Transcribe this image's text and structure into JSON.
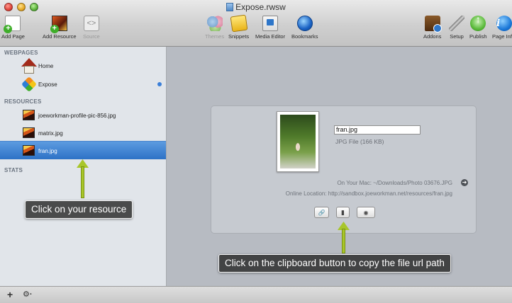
{
  "window": {
    "title": "Expose.rwsw"
  },
  "toolbar": {
    "add_page": "Add Page",
    "add_resource": "Add Resource",
    "source": "Source",
    "themes": "Themes",
    "snippets": "Snippets",
    "media_editor": "Media Editor",
    "bookmarks": "Bookmarks",
    "addons": "Addons",
    "setup": "Setup",
    "publish": "Publish",
    "page_info": "Page Info",
    "source_glyph": "<>",
    "info_glyph": "i"
  },
  "sidebar": {
    "webpages_header": "WEBPAGES",
    "webpages": [
      {
        "label": "Home"
      },
      {
        "label": "Expose"
      }
    ],
    "resources_header": "RESOURCES",
    "resources": [
      {
        "label": "joeworkman-profile-pic-856.jpg"
      },
      {
        "label": "matrix.jpg"
      },
      {
        "label": "fran.jpg"
      }
    ],
    "stats_header": "STATS"
  },
  "bottombar": {
    "add_glyph": "+",
    "gear_glyph": "⚙·"
  },
  "resource_panel": {
    "file_name": "fran.jpg",
    "file_type": "JPG File (166 KB)",
    "on_your_mac": "On Your Mac: ~/Downloads/Photo 03676.JPG",
    "online_location": "Online Location: http://sandbox.joeworkman.net/resources/fran.jpg",
    "arrow_glyph": "➜",
    "buttons": {
      "link_glyph": "🔗",
      "clipboard_glyph": "▮",
      "preview_glyph": "◉"
    }
  },
  "callouts": {
    "resource": "Click on your resource",
    "clipboard": "Click on the clipboard button to copy the file url path"
  },
  "colors": {
    "selection": "#2e72c6",
    "arrow_green": "#a8c62a",
    "sidebar_bg": "#e1e5ea",
    "main_bg": "#b7bbc2"
  }
}
